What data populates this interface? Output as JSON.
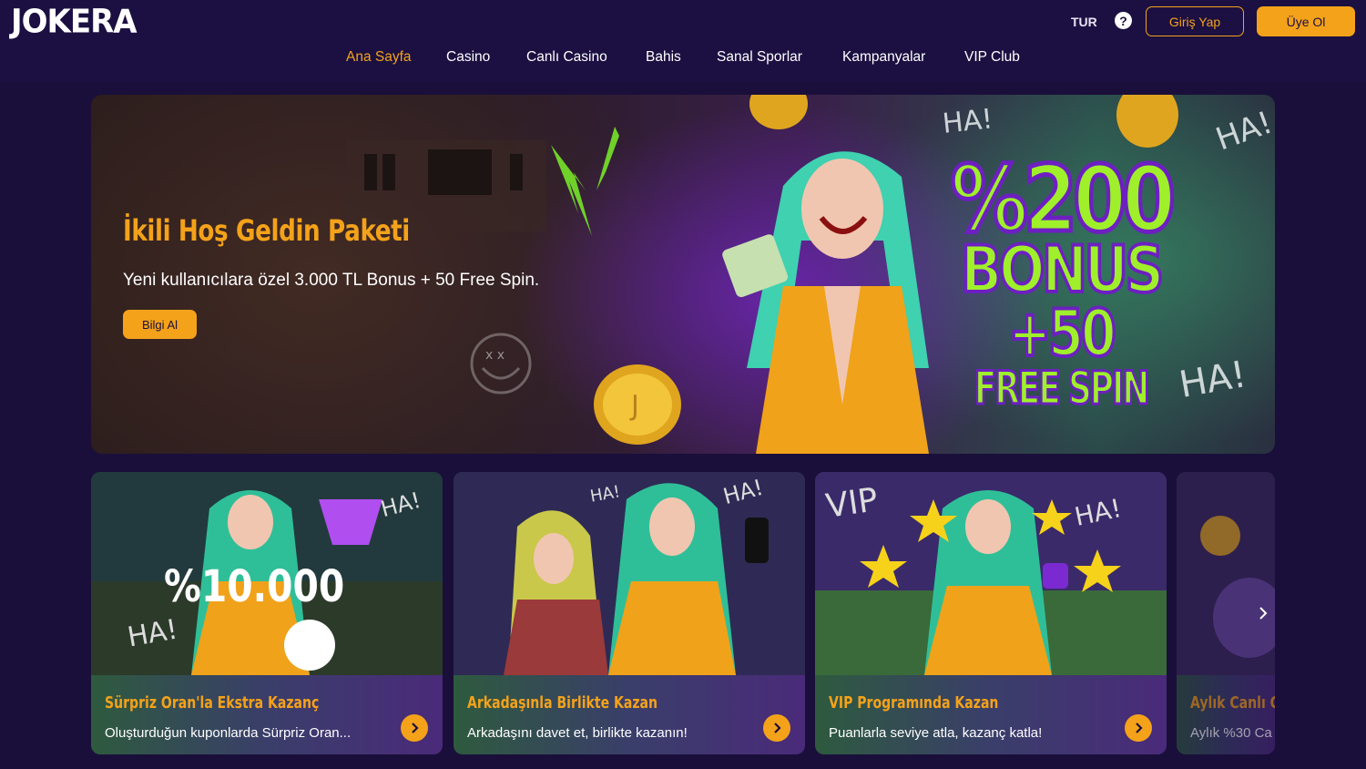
{
  "brand": {
    "logo_text": "JOKERA",
    "accent": "#f4a21a",
    "background": "#1a0f3a"
  },
  "header": {
    "language": "TUR",
    "help_icon": "question-circle-icon",
    "login_label": "Giriş Yap",
    "register_label": "Üye Ol"
  },
  "nav": {
    "items": [
      {
        "label": "Ana Sayfa",
        "active": true
      },
      {
        "label": "Casino"
      },
      {
        "label": "Canlı Casino"
      },
      {
        "label": "Bahis"
      },
      {
        "label": "Sanal Sporlar"
      },
      {
        "label": "Kampanyalar"
      },
      {
        "label": "VIP Club"
      }
    ]
  },
  "hero": {
    "title": "İkili Hoş Geldin Paketi",
    "subtitle": "Yeni kullanıcılara özel 3.000 TL Bonus + 50 Free Spin.",
    "button_label": "Bilgi Al",
    "promo": {
      "line1": "%200",
      "line2": "BONUS",
      "line3": "+50",
      "line4": "FREE SPIN"
    },
    "decorations": {
      "ha1": "HA!",
      "ha2": "HA!",
      "ha3": "HA!"
    }
  },
  "cards": [
    {
      "title": "Sürpriz Oran'la Ekstra Kazanç",
      "description": "Oluşturduğun kuponlarda Sürpriz Oran...",
      "image_text": "%10.000",
      "ha1": "HA!",
      "ha2": "HA!"
    },
    {
      "title": "Arkadaşınla Birlikte Kazan",
      "description": "Arkadaşını davet et, birlikte kazanın!",
      "ha1": "HA!",
      "ha2": "HA!"
    },
    {
      "title": "VIP Programında Kazan",
      "description": "Puanlarla seviye atla, kazanç katla!",
      "image_text": "VIP",
      "ha1": "HA!"
    },
    {
      "title": "Aylık Canlı Ca",
      "description": "Aylık %30 Ca"
    }
  ],
  "slider": {
    "next_icon": "chevron-right-icon"
  }
}
